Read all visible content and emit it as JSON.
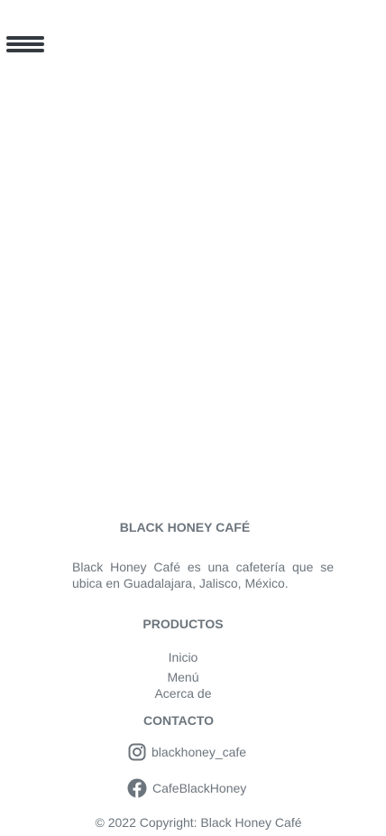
{
  "header": {
    "menu_icon": "hamburger-menu-icon"
  },
  "footer": {
    "brand_title": "BLACK HONEY CAFÉ",
    "description": "Black Honey Café es una cafetería que se ubica en Guadalajara, Jalisco, México.",
    "products_title": "PRODUCTOS",
    "links": [
      "Inicio",
      "Menú",
      "Acerca de"
    ],
    "contact_title": "CONTACTO",
    "instagram": {
      "icon": "instagram-icon",
      "handle": "blackhoney_cafe"
    },
    "facebook": {
      "icon": "facebook-icon",
      "handle": "CafeBlackHoney"
    },
    "copyright": "© 2022 Copyright: Black Honey Café"
  },
  "colors": {
    "text": "#6c757d",
    "menu_icon": "#343a40",
    "background": "#ffffff"
  }
}
